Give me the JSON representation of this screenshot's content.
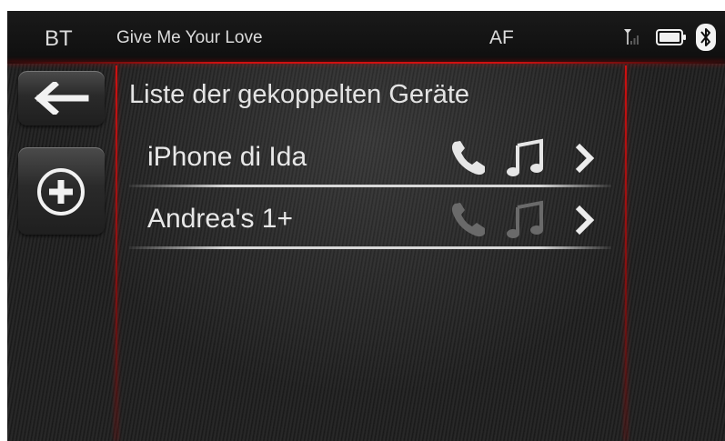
{
  "status_bar": {
    "source": "BT",
    "song_title": "Give Me Your Love",
    "radio_mode": "AF",
    "icons": [
      "signal-icon",
      "battery-icon",
      "bluetooth-icon"
    ]
  },
  "side_buttons": {
    "back": "back-arrow-icon",
    "add": "plus-circle-icon"
  },
  "list": {
    "title": "Liste der gekoppelten Geräte",
    "devices": [
      {
        "name": "iPhone di Ida",
        "phone_active": true,
        "music_active": true
      },
      {
        "name": "Andrea's 1+",
        "phone_active": false,
        "music_active": false
      }
    ]
  },
  "colors": {
    "accent_red": "#d01010",
    "icon_active": "#e6e6e6",
    "icon_inactive": "#6a6a6a",
    "text": "#e8e8e8"
  }
}
